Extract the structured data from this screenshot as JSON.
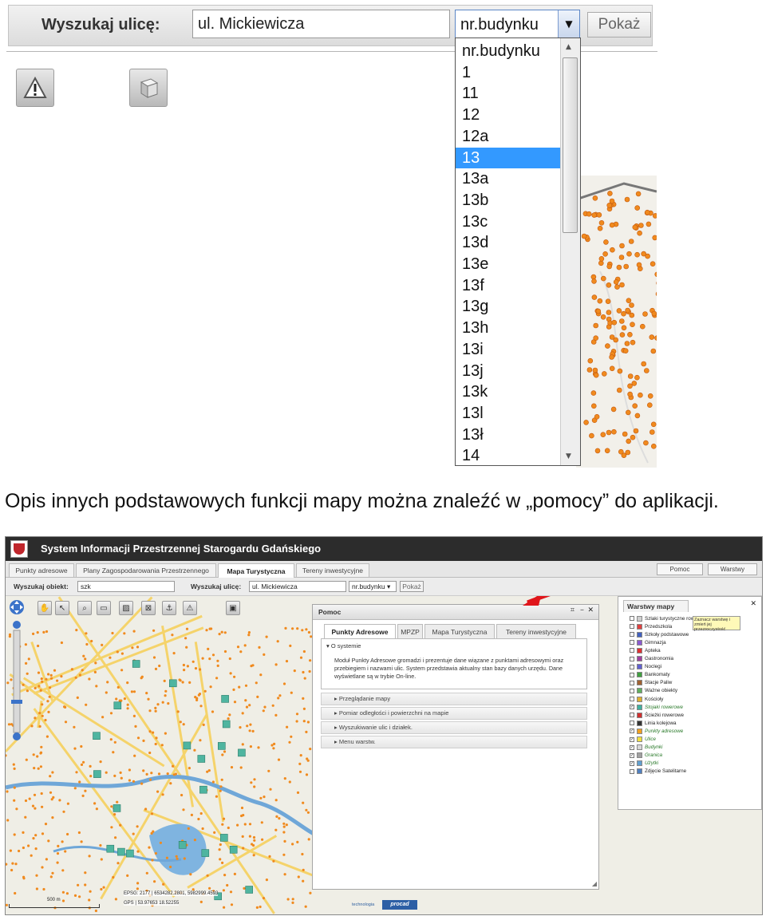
{
  "top": {
    "search_label": "Wyszukaj ulicę:",
    "street_value": "ul. Mickiewicza",
    "building_selected": "nr.budynku",
    "show_button": "Pokaż",
    "dropdown_options": [
      "nr.budynku",
      "1",
      "11",
      "12",
      "12a",
      "13",
      "13a",
      "13b",
      "13c",
      "13d",
      "13e",
      "13f",
      "13g",
      "13h",
      "13i",
      "13j",
      "13k",
      "13l",
      "13ł",
      "14"
    ],
    "dropdown_highlighted": "13"
  },
  "caption": "Opis innych podstawowych funkcji mapy można znaleźć w „pomocy” do aplikacji.",
  "app": {
    "title": "System Informacji Przestrzennej Starogardu Gdańskiego",
    "tabs": [
      {
        "label": "Punkty adresowe",
        "active": false
      },
      {
        "label": "Plany Zagospodarowania Przestrzennego",
        "active": false
      },
      {
        "label": "Mapa Turystyczna",
        "active": true
      },
      {
        "label": "Tereny inwestycyjne",
        "active": false
      }
    ],
    "help_button": "Pomoc",
    "layers_button": "Warstwy",
    "search_object_label": "Wyszukaj obiekt:",
    "search_object_value": "szk",
    "search_street_label": "Wyszukaj ulicę:",
    "search_street_value": "ul. Mickiewicza",
    "building_select": "nr.budynku",
    "show_button": "Pokaż",
    "help_window": {
      "title": "Pomoc",
      "tabs": [
        "Punkty Adresowe",
        "MPZP",
        "Mapa Turystyczna",
        "Tereny inwestycyjne"
      ],
      "section_title": "O systemie",
      "section_text": "Moduł Punkty Adresowe gromadzi i prezentuje dane wiązane z punktami adresowymi oraz przebiegiem i nazwami ulic. System przedstawia aktualny stan bazy danych urzędu. Dane wyświetlane są w trybie On-line.",
      "accordion": [
        "Przeglądanie mapy",
        "Pomiar odległości i powierzchni na mapie",
        "Wyszukiwanie ulic i działek.",
        "Menu warstw."
      ]
    },
    "layers_panel": {
      "title": "Warstwy mapy",
      "tooltip": "Zaznacz warstwę i zmień jej przezroczystość",
      "items": [
        {
          "label": "Szlaki turystyczne rowerowe",
          "checked": false,
          "color": "#d0d0d0"
        },
        {
          "label": "Przedszkola",
          "checked": false,
          "color": "#e04040"
        },
        {
          "label": "Szkoły podstawowe",
          "checked": false,
          "color": "#4060c0"
        },
        {
          "label": "Gimnazja",
          "checked": false,
          "color": "#8a5ad0"
        },
        {
          "label": "Apteka",
          "checked": false,
          "color": "#e03030"
        },
        {
          "label": "Gastronomia",
          "checked": false,
          "color": "#a040a0"
        },
        {
          "label": "Noclegi",
          "checked": false,
          "color": "#6060d0"
        },
        {
          "label": "Bankomaty",
          "checked": false,
          "color": "#40a040"
        },
        {
          "label": "Stacje Paliw",
          "checked": false,
          "color": "#a06030"
        },
        {
          "label": "Ważne obiekty",
          "checked": false,
          "color": "#60b060"
        },
        {
          "label": "Kościoły",
          "checked": false,
          "color": "#e0b030"
        },
        {
          "label": "Stojaki rowerowe",
          "checked": true,
          "color": "#40b0a0"
        },
        {
          "label": "Ścieżki rowerowe",
          "checked": false,
          "color": "#d03030"
        },
        {
          "label": "Linia kolejowa",
          "checked": false,
          "color": "#333333"
        },
        {
          "label": "Punkty adresowe",
          "checked": true,
          "color": "#f0a020"
        },
        {
          "label": "Ulice",
          "checked": true,
          "color": "#f0e040"
        },
        {
          "label": "Budynki",
          "checked": true,
          "color": "#d8d8d8"
        },
        {
          "label": "Granica",
          "checked": true,
          "color": "#a0a0a0"
        },
        {
          "label": "Użytki",
          "checked": true,
          "color": "#60a0d0"
        },
        {
          "label": "Zdjęcie Satelitarne",
          "checked": false,
          "color": "#5080c0"
        }
      ]
    },
    "footer": {
      "scale": "500 m",
      "epsg": "EPSG: 2177 | 6534282.2801, 5982999.4593",
      "gps": "GPS | 53.97653 18.52255",
      "tech_label": "technologia",
      "brand": "procad"
    }
  }
}
